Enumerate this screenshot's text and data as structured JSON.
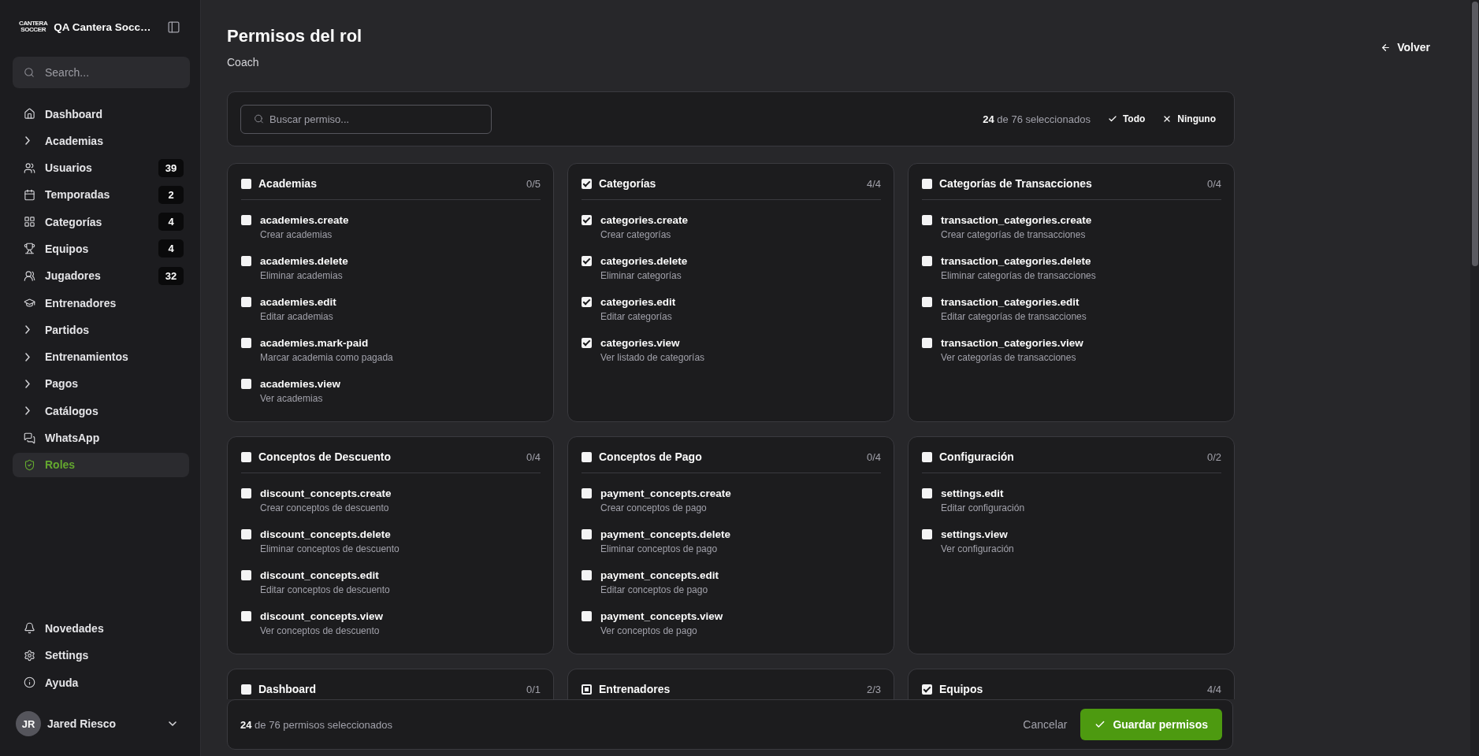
{
  "sidebar": {
    "logo_lines": [
      "CANTERA",
      "SOCCER"
    ],
    "workspace": "QA Cantera Socc…",
    "search": {
      "placeholder": "Search..."
    },
    "nav": [
      {
        "label": "Dashboard",
        "kind": "link",
        "selected": false
      },
      {
        "label": "Academias",
        "kind": "group",
        "selected": false
      },
      {
        "label": "Usuarios",
        "kind": "link",
        "badge": "39",
        "selected": false
      },
      {
        "label": "Temporadas",
        "kind": "link",
        "badge": "2",
        "selected": false
      },
      {
        "label": "Categorías",
        "kind": "link",
        "badge": "4",
        "selected": false
      },
      {
        "label": "Equipos",
        "kind": "link",
        "badge": "4",
        "selected": false
      },
      {
        "label": "Jugadores",
        "kind": "link",
        "badge": "32",
        "selected": false
      },
      {
        "label": "Entrenadores",
        "kind": "link",
        "selected": false
      },
      {
        "label": "Partidos",
        "kind": "group",
        "selected": false
      },
      {
        "label": "Entrenamientos",
        "kind": "group",
        "selected": false
      },
      {
        "label": "Pagos",
        "kind": "group",
        "selected": false
      },
      {
        "label": "Catálogos",
        "kind": "group",
        "selected": false
      },
      {
        "label": "WhatsApp",
        "kind": "link",
        "selected": false
      },
      {
        "label": "Roles",
        "kind": "link",
        "selected": true
      }
    ],
    "footer_nav": [
      {
        "label": "Novedades"
      },
      {
        "label": "Settings"
      },
      {
        "label": "Ayuda"
      }
    ],
    "user": {
      "initials": "JR",
      "name": "Jared Riesco"
    }
  },
  "header": {
    "title": "Permisos del rol",
    "subtitle": "Coach",
    "back_button": "Volver"
  },
  "toolbar": {
    "search": {
      "placeholder": "Buscar permiso..."
    },
    "selection": "**24** de 76 seleccionados",
    "select_all": "Todo",
    "select_none": "Ninguno"
  },
  "groups": [
    {
      "title": "Academias",
      "count": "0/5",
      "checked": false,
      "indeterminate": false,
      "permissions": [
        {
          "name": "academies.create",
          "description": "Crear academias",
          "checked": false
        },
        {
          "name": "academies.delete",
          "description": "Eliminar academias",
          "checked": false
        },
        {
          "name": "academies.edit",
          "description": "Editar academias",
          "checked": false
        },
        {
          "name": "academies.mark-paid",
          "description": "Marcar academia como pagada",
          "checked": false
        },
        {
          "name": "academies.view",
          "description": "Ver academias",
          "checked": false
        }
      ]
    },
    {
      "title": "Categorías",
      "count": "4/4",
      "checked": true,
      "indeterminate": false,
      "permissions": [
        {
          "name": "categories.create",
          "description": "Crear categorías",
          "checked": true
        },
        {
          "name": "categories.delete",
          "description": "Eliminar categorías",
          "checked": true
        },
        {
          "name": "categories.edit",
          "description": "Editar categorías",
          "checked": true
        },
        {
          "name": "categories.view",
          "description": "Ver listado de categorías",
          "checked": true
        }
      ]
    },
    {
      "title": "Categorías de Transacciones",
      "count": "0/4",
      "checked": false,
      "indeterminate": false,
      "permissions": [
        {
          "name": "transaction_categories.create",
          "description": "Crear categorías de transacciones",
          "checked": false
        },
        {
          "name": "transaction_categories.delete",
          "description": "Eliminar categorías de transacciones",
          "checked": false
        },
        {
          "name": "transaction_categories.edit",
          "description": "Editar categorías de transacciones",
          "checked": false
        },
        {
          "name": "transaction_categories.view",
          "description": "Ver categorías de transacciones",
          "checked": false
        }
      ]
    },
    {
      "title": "Conceptos de Descuento",
      "count": "0/4",
      "checked": false,
      "indeterminate": false,
      "permissions": [
        {
          "name": "discount_concepts.create",
          "description": "Crear conceptos de descuento",
          "checked": false
        },
        {
          "name": "discount_concepts.delete",
          "description": "Eliminar conceptos de descuento",
          "checked": false
        },
        {
          "name": "discount_concepts.edit",
          "description": "Editar conceptos de descuento",
          "checked": false
        },
        {
          "name": "discount_concepts.view",
          "description": "Ver conceptos de descuento",
          "checked": false
        }
      ]
    },
    {
      "title": "Conceptos de Pago",
      "count": "0/4",
      "checked": false,
      "indeterminate": false,
      "permissions": [
        {
          "name": "payment_concepts.create",
          "description": "Crear conceptos de pago",
          "checked": false
        },
        {
          "name": "payment_concepts.delete",
          "description": "Eliminar conceptos de pago",
          "checked": false
        },
        {
          "name": "payment_concepts.edit",
          "description": "Editar conceptos de pago",
          "checked": false
        },
        {
          "name": "payment_concepts.view",
          "description": "Ver conceptos de pago",
          "checked": false
        }
      ]
    },
    {
      "title": "Configuración",
      "count": "0/2",
      "checked": false,
      "indeterminate": false,
      "permissions": [
        {
          "name": "settings.edit",
          "description": "Editar configuración",
          "checked": false
        },
        {
          "name": "settings.view",
          "description": "Ver configuración",
          "checked": false
        }
      ]
    },
    {
      "title": "Dashboard",
      "count": "0/1",
      "checked": false,
      "indeterminate": false
    },
    {
      "title": "Entrenadores",
      "count": "2/3",
      "checked": false,
      "indeterminate": true
    },
    {
      "title": "Equipos",
      "count": "4/4",
      "checked": true,
      "indeterminate": false
    }
  ],
  "action_bar": {
    "summary": "**24** de 76 permisos seleccionados",
    "cancel": "Cancelar",
    "save": "Guardar permisos"
  }
}
